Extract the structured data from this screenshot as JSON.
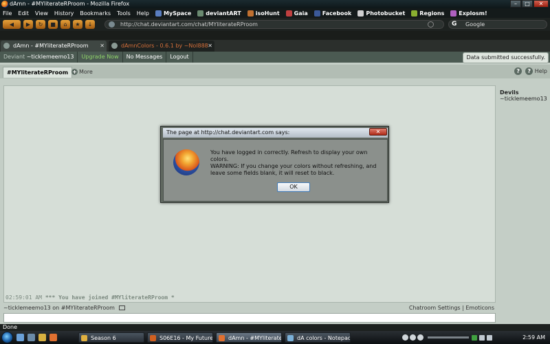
{
  "window": {
    "title": "dAmn - #MYliterateRProom - Mozilla Firefox",
    "min": "–",
    "max": "□",
    "close": "✕"
  },
  "menu": [
    "File",
    "Edit",
    "View",
    "History",
    "Bookmarks",
    "Tools",
    "Help"
  ],
  "bookmarks": [
    {
      "label": "MySpace",
      "color": "#5a7ec0"
    },
    {
      "label": "deviantART",
      "color": "#6a8a70"
    },
    {
      "label": "isoHunt",
      "color": "#c07030"
    },
    {
      "label": "Gaia",
      "color": "#c04040"
    },
    {
      "label": "Facebook",
      "color": "#3b5998"
    },
    {
      "label": "Photobucket",
      "color": "#d0d0d0"
    },
    {
      "label": "Regions",
      "color": "#8ab030"
    },
    {
      "label": "Explosm!",
      "color": "#b060c0"
    }
  ],
  "nav": {
    "url": "http://chat.deviantart.com/chat/MYliterateRProom",
    "search_placeholder": "Google",
    "search_logo": "G"
  },
  "tabs": [
    {
      "label": "dAmn - #MYliterateRProom",
      "close": "✕"
    },
    {
      "label": "dAmnColors - 0.6.1 by ~Nol888 o...",
      "close": "✕"
    }
  ],
  "dabar": {
    "deviant_label": "Deviant",
    "username": "~ticklemeemo13",
    "upgrade": "Upgrade Now",
    "messages": "No Messages",
    "logout": "Logout"
  },
  "tooltip": "Data submitted successfully.",
  "room": {
    "tab": "#MYliterateRProom",
    "more": "More",
    "help": "Help",
    "help_q": "?"
  },
  "chat": {
    "joined_time": "02:59:01 AM",
    "joined_text": "*** You have joined #MYliterateRProom *"
  },
  "members": {
    "group": "Devils",
    "member": "~ticklemeemo13"
  },
  "footer": {
    "status": "~ticklemeemo13 on #MYliterateRProom",
    "settings": "Chatroom Settings | Emoticons"
  },
  "statusbar": "Done",
  "taskbar": {
    "tasks": [
      {
        "label": "Season 6",
        "color": "#e0b040"
      },
      {
        "label": "S06E16 - My Future ...",
        "color": "#d06020"
      },
      {
        "label": "dAmn - #MYliterate...",
        "color": "#e07030"
      },
      {
        "label": "dA colors - Notepad",
        "color": "#7ab0d8"
      }
    ],
    "clock": "2:59 AM"
  },
  "dialog": {
    "title": "The page at http://chat.deviantart.com says:",
    "close": "✕",
    "line1": "You have logged in correctly. Refresh to display your own colors.",
    "line2": "WARNING: If you change your colors without refreshing, and leave some fields blank, it will reset to black.",
    "ok": "OK"
  }
}
